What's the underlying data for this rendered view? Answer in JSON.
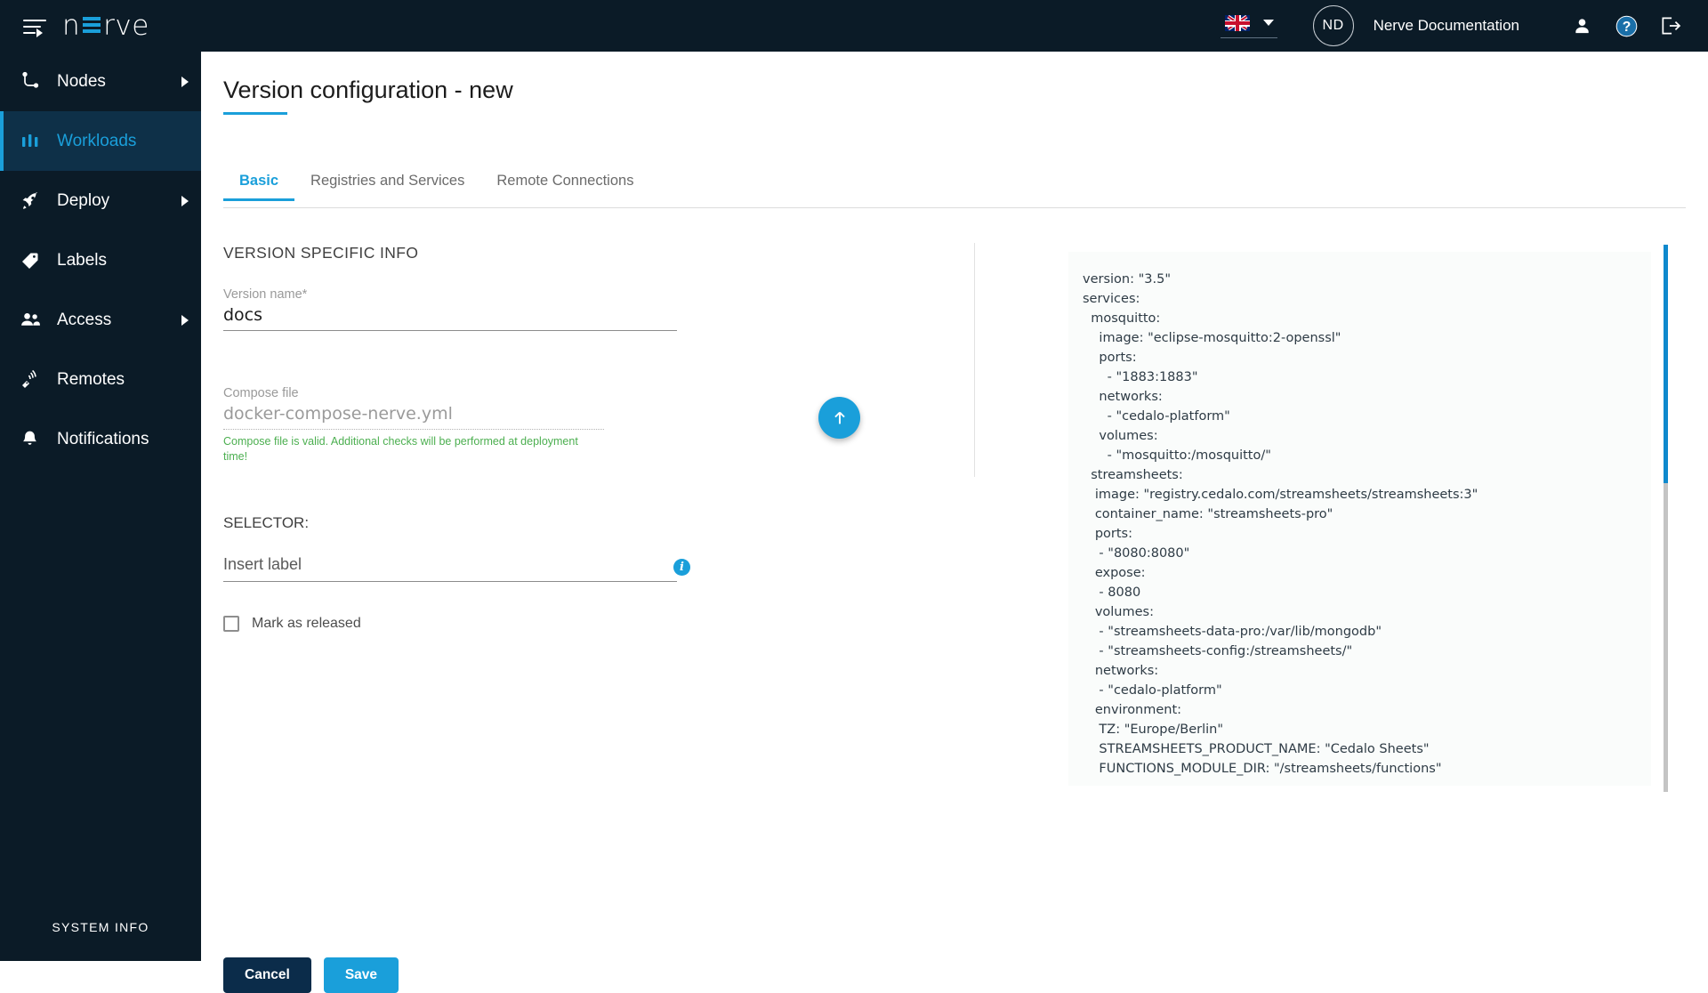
{
  "header": {
    "menu_icon": "hamburger-menu-icon",
    "logo_text_left": "n",
    "logo_text_right": "rve",
    "language_flag": "uk-flag-icon",
    "language_caret": "chevron-down-icon",
    "avatar_initials": "ND",
    "username": "Nerve Documentation",
    "profile_icon": "person-icon",
    "help_icon": "question-mark-icon",
    "logout_icon": "logout-icon"
  },
  "sidebar": {
    "items": [
      {
        "label": "Nodes",
        "icon": "nodes-icon",
        "active": false,
        "expandable": true
      },
      {
        "label": "Workloads",
        "icon": "workloads-icon",
        "active": true,
        "expandable": false
      },
      {
        "label": "Deploy",
        "icon": "rocket-icon",
        "active": false,
        "expandable": true
      },
      {
        "label": "Labels",
        "icon": "tag-icon",
        "active": false,
        "expandable": false
      },
      {
        "label": "Access",
        "icon": "users-icon",
        "active": false,
        "expandable": true
      },
      {
        "label": "Remotes",
        "icon": "remote-icon",
        "active": false,
        "expandable": false
      },
      {
        "label": "Notifications",
        "icon": "bell-icon",
        "active": false,
        "expandable": false
      }
    ],
    "system_info": "SYSTEM INFO"
  },
  "page": {
    "title": "Version configuration - new",
    "tabs": [
      {
        "label": "Basic",
        "active": true
      },
      {
        "label": "Registries and Services",
        "active": false
      },
      {
        "label": "Remote Connections",
        "active": false
      }
    ]
  },
  "form": {
    "section_title": "VERSION SPECIFIC INFO",
    "version_name_label": "Version name*",
    "version_name_value": "docs",
    "compose_file_label": "Compose file",
    "compose_file_value": "docker-compose-nerve.yml",
    "validation_message": "Compose file is valid. Additional checks will be performed at deployment time!",
    "upload_icon": "upload-arrow-up-icon",
    "selector_title": "SELECTOR:",
    "selector_placeholder": "Insert label",
    "selector_info_icon": "info-icon",
    "released_checkbox_label": "Mark as released",
    "released_checked": false
  },
  "footer": {
    "cancel_label": "Cancel",
    "save_label": "Save"
  },
  "yaml": {
    "content": "version: \"3.5\"\nservices:\n  mosquitto:\n    image: \"eclipse-mosquitto:2-openssl\"\n    ports:\n      - \"1883:1883\"\n    networks:\n      - \"cedalo-platform\"\n    volumes:\n      - \"mosquitto:/mosquitto/\"\n  streamsheets:\n   image: \"registry.cedalo.com/streamsheets/streamsheets:3\"\n   container_name: \"streamsheets-pro\"\n   ports:\n    - \"8080:8080\"\n   expose:\n    - 8080\n   volumes:\n    - \"streamsheets-data-pro:/var/lib/mongodb\"\n    - \"streamsheets-config:/streamsheets/\"\n   networks:\n    - \"cedalo-platform\"\n   environment:\n    TZ: \"Europe/Berlin\"\n    STREAMSHEETS_PRODUCT_NAME: \"Cedalo Sheets\"\n    FUNCTIONS_MODULE_DIR: \"/streamsheets/functions\""
  },
  "colors": {
    "accent_blue": "#1a9fda",
    "dark_navy": "#0b1b27",
    "active_nav_bg": "#0e3048",
    "valid_green": "#4caf50",
    "cancel_navy": "#0b2c4a"
  }
}
